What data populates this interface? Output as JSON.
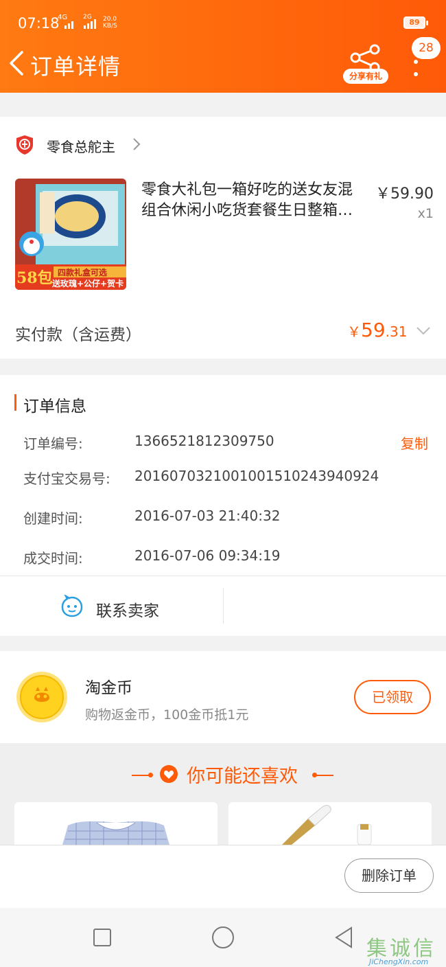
{
  "status_bar": {
    "time": "07:18",
    "network": "4G",
    "network2": "2G",
    "speed_value": "20.0",
    "speed_unit": "KB/S",
    "battery": "89"
  },
  "header": {
    "title": "订单详情",
    "share_label": "分享有礼",
    "message_count": "28"
  },
  "shop": {
    "name": "零食总舵主"
  },
  "product": {
    "title": "零食大礼包一箱好吃的送女友混组合休闲小吃货套餐生日整箱…",
    "price": "￥59.90",
    "quantity": "x1",
    "image_text_count": "58包",
    "image_text_line1": "四款礼盒可选",
    "image_text_line2": "送玫瑰+公仔+贺卡"
  },
  "payment": {
    "label": "实付款（含运费）",
    "currency": "￥",
    "amount_int": "59",
    "amount_dec": ".31"
  },
  "order_info": {
    "section_title": "订单信息",
    "rows": [
      {
        "label": "订单编号:",
        "value": "1366521812309750"
      },
      {
        "label": "支付宝交易号:",
        "value": "2016070321001001510243940924"
      },
      {
        "label": "创建时间:",
        "value": "2016-07-03 21:40:32"
      },
      {
        "label": "成交时间:",
        "value": "2016-07-06 09:34:19"
      }
    ],
    "copy_label": "复制"
  },
  "contact": {
    "label": "联系卖家"
  },
  "coins": {
    "title": "淘金币",
    "description": "购物返金币，100金币抵1元",
    "button_label": "已领取"
  },
  "recommend": {
    "title": "你可能还喜欢"
  },
  "actions": {
    "delete_label": "删除订单"
  },
  "watermark": {
    "text": "集诚信",
    "sub": "JiChengXin.com"
  },
  "colors": {
    "accent": "#ff5a08",
    "header_start": "#ff7a12",
    "contact_blue": "#2a9fe0",
    "coin_yellow": "#ffd21f"
  }
}
